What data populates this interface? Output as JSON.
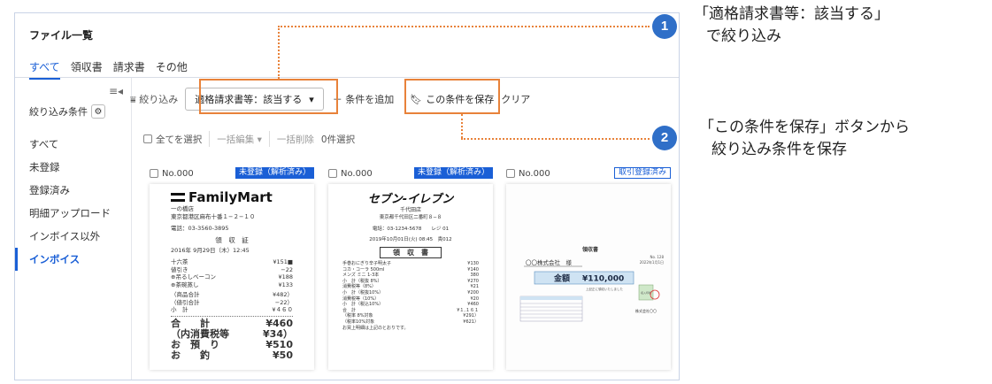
{
  "page": {
    "title": "ファイル一覧"
  },
  "tabs": [
    "すべて",
    "領収書",
    "請求書",
    "その他"
  ],
  "sidebar": {
    "filter_label": "絞り込み条件",
    "items": [
      "すべて",
      "未登録",
      "登録済み",
      "明細アップロード",
      "インボイス以外",
      "インボイス"
    ],
    "active_index": 5
  },
  "toolbar": {
    "filter": "絞り込み",
    "chip": "適格請求書等：該当する",
    "add": "条件を追加",
    "save": "この条件を保存",
    "clear": "クリア"
  },
  "bulk": {
    "select_all": "全てを選択",
    "bulk_edit": "一括編集",
    "bulk_delete": "一括削除",
    "selected": "0件選択"
  },
  "cards": [
    {
      "no": "No.000",
      "badge": "未登録（解析済み）",
      "badge_style": "solid"
    },
    {
      "no": "No.000",
      "badge": "未登録（解析済み）",
      "badge_style": "solid"
    },
    {
      "no": "No.000",
      "badge": "取引登録済み",
      "badge_style": "outline"
    }
  ],
  "receipt_fm": {
    "logo": "FamilyMart",
    "store": "一の橋店",
    "address": "東京都港区麻布十番１−２−１０",
    "phone": "電話：03-3560-3895",
    "heading": "領　収　証",
    "date": "2016年 9月29日（木）12:45",
    "items": [
      [
        "十六茶",
        "¥151■"
      ],
      [
        "値引き",
        "−22"
      ],
      [
        "⊕吊るしベーコン",
        "¥188"
      ],
      [
        "⊕茶碗蒸し",
        "¥133"
      ]
    ],
    "subtotals": [
      [
        "（商品合計",
        "¥482）"
      ],
      [
        "（値引合計",
        "−22）"
      ],
      [
        "小　計",
        "¥４６０"
      ]
    ],
    "totals": [
      [
        "合　　計",
        "¥460"
      ],
      [
        "（内消費税等",
        "¥34）"
      ],
      [
        "お　預　り",
        "¥510"
      ],
      [
        "お　　釣",
        "¥50"
      ]
    ]
  },
  "receipt_se": {
    "logo": "セブン-イレブン",
    "store": "千代田店",
    "address": "東京都千代田区二番町８−８",
    "phone": "電話：03-1234-5678　　レジ 01",
    "date": "2019年10月01日(火) 08:45　責012",
    "heading": "領　収　書",
    "lines": [
      [
        "手巻おにぎり辛子明太子",
        "¥130"
      ],
      [
        "コカ・コーラ 500ml",
        "¥140"
      ],
      [
        "メンズ ミニ 1-3本",
        "380"
      ],
      [
        "小　計（税抜 8%）",
        "¥270"
      ],
      [
        "消費税等（8%）",
        "¥21"
      ],
      [
        "小　計（税抜10%）",
        "¥200"
      ],
      [
        "消費税等（10%）",
        "¥20"
      ],
      [
        "小　計（税込10%）",
        "¥460"
      ],
      [
        "合　計",
        "¥１,１６１"
      ],
      [
        "（税率 8%対象",
        "¥291）"
      ],
      [
        "（税率10%対象",
        "¥621）"
      ],
      [
        "お買上明細は上記のとおりです。",
        ""
      ]
    ]
  },
  "invoice": {
    "title": "領収書",
    "no": "No. 128",
    "date": "2022年1月1日",
    "company": "〇〇株式会社　様",
    "amount_label": "金額",
    "amount": "¥110,000",
    "note": "上記正に領収いたしました",
    "issuer": "株式会社〇〇",
    "stamp": "収入印紙"
  },
  "callouts": [
    {
      "num": "1",
      "lines": [
        "「適格請求書等：該当する」",
        "で絞り込み"
      ]
    },
    {
      "num": "2",
      "lines": [
        "「この条件を保存」ボタンから",
        "絞り込み条件を保存"
      ]
    }
  ],
  "colors": {
    "accent": "#1a5fd6",
    "highlight": "#e8823a",
    "callout_circle": "#2f6fc8"
  }
}
